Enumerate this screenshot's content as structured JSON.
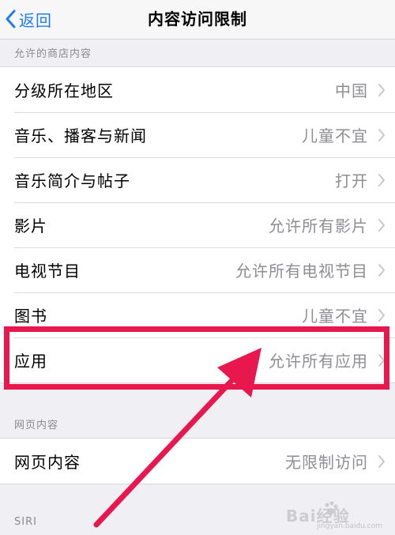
{
  "nav": {
    "back_label": "返回",
    "title": "内容访问限制"
  },
  "sections": [
    {
      "header": "允许的商店内容",
      "rows": [
        {
          "label": "分级所在地区",
          "value": "中国"
        },
        {
          "label": "音乐、播客与新闻",
          "value": "儿童不宜"
        },
        {
          "label": "音乐简介与帖子",
          "value": "打开"
        },
        {
          "label": "影片",
          "value": "允许所有影片"
        },
        {
          "label": "电视节目",
          "value": "允许所有电视节目"
        },
        {
          "label": "图书",
          "value": "儿童不宜"
        },
        {
          "label": "应用",
          "value": "允许所有应用"
        }
      ]
    },
    {
      "header": "网页内容",
      "rows": [
        {
          "label": "网页内容",
          "value": "无限制访问"
        }
      ]
    },
    {
      "header": "SIRI"
    }
  ],
  "watermark": {
    "text": "Bai经验",
    "sub": "jingyan.baidu.com"
  },
  "colors": {
    "accent": "#1f7cf6",
    "highlight": "#e8174d"
  },
  "icons": {
    "back": "chevron-left-icon",
    "disclosure": "chevron-right-icon",
    "annotation": "arrow-icon",
    "watermark": "paw-icon"
  }
}
